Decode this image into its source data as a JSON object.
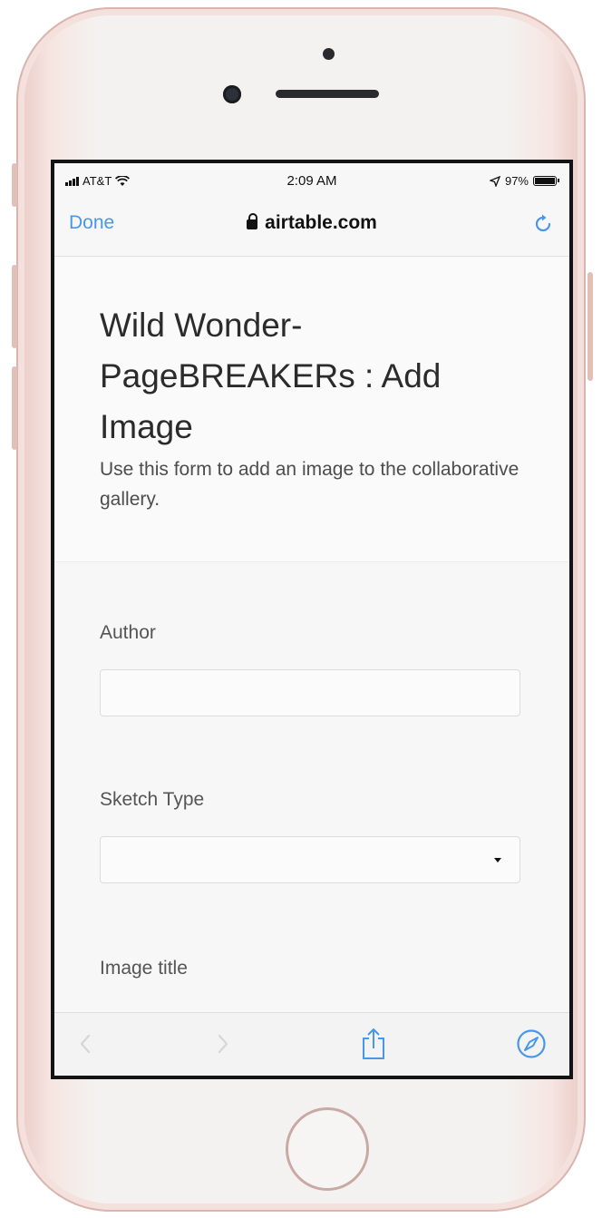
{
  "statusbar": {
    "carrier": "AT&T",
    "time": "2:09 AM",
    "battery_percent": "97%"
  },
  "navbar": {
    "done_label": "Done",
    "url": "airtable.com"
  },
  "form": {
    "title": "Wild Wonder-PageBREAKERs : Add Image",
    "description": "Use this form to add an image to the collaborative gallery.",
    "fields": [
      {
        "label": "Author",
        "value": ""
      },
      {
        "label": "Sketch Type",
        "value": ""
      },
      {
        "label": "Image title"
      }
    ]
  },
  "toolbar": {
    "icons": [
      "back-icon",
      "forward-icon",
      "share-icon",
      "compass-icon"
    ]
  },
  "colors": {
    "link_blue": "#4a96e8",
    "phone_rose": "#e9c9c4"
  }
}
